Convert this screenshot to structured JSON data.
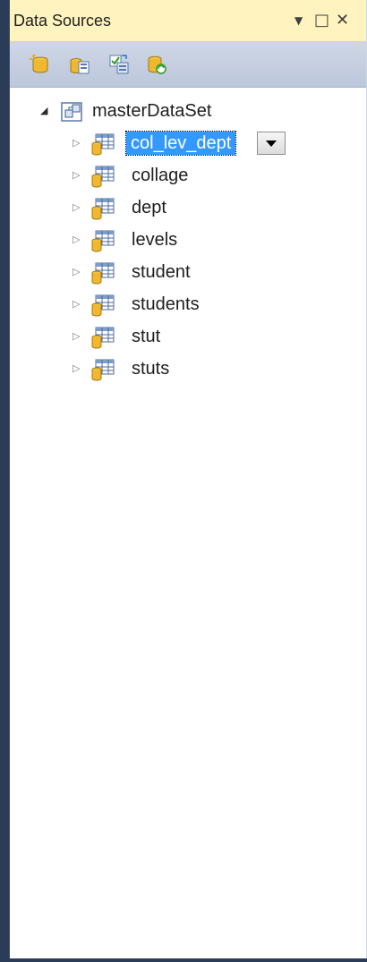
{
  "panel": {
    "title": "Data Sources",
    "buttons": {
      "dropdown": "▼",
      "maximize": "□",
      "close": "✕"
    }
  },
  "toolbar": {
    "icons": [
      "add-data-source-icon",
      "edit-in-designer-icon",
      "configure-dataset-icon",
      "refresh-icon"
    ]
  },
  "tree": {
    "root": {
      "label": "masterDataSet",
      "expanded": true,
      "icon": "dataset-icon"
    },
    "items": [
      {
        "label": "col_lev_dept",
        "selected": true
      },
      {
        "label": "collage"
      },
      {
        "label": "dept"
      },
      {
        "label": "levels"
      },
      {
        "label": "student"
      },
      {
        "label": "students"
      },
      {
        "label": "stut"
      },
      {
        "label": "stuts"
      }
    ]
  },
  "colors": {
    "title_bar": "#fff4bf",
    "toolbar": "#c8d1e1",
    "selection": "#3399ff",
    "frame": "#2b3c59"
  }
}
